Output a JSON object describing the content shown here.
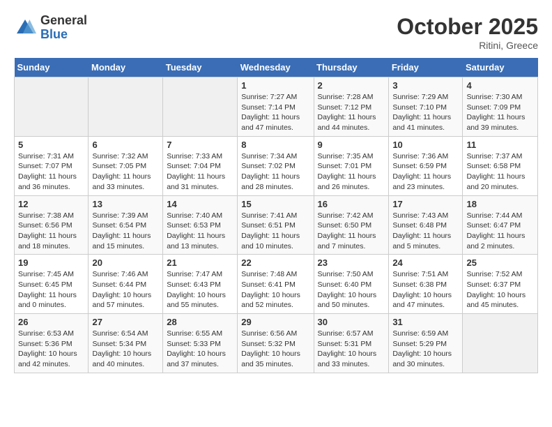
{
  "header": {
    "logo_general": "General",
    "logo_blue": "Blue",
    "title": "October 2025",
    "subtitle": "Ritini, Greece"
  },
  "weekdays": [
    "Sunday",
    "Monday",
    "Tuesday",
    "Wednesday",
    "Thursday",
    "Friday",
    "Saturday"
  ],
  "weeks": [
    [
      {
        "day": "",
        "empty": true
      },
      {
        "day": "",
        "empty": true
      },
      {
        "day": "",
        "empty": true
      },
      {
        "day": "1",
        "sunrise": "7:27 AM",
        "sunset": "7:14 PM",
        "daylight": "11 hours and 47 minutes."
      },
      {
        "day": "2",
        "sunrise": "7:28 AM",
        "sunset": "7:12 PM",
        "daylight": "11 hours and 44 minutes."
      },
      {
        "day": "3",
        "sunrise": "7:29 AM",
        "sunset": "7:10 PM",
        "daylight": "11 hours and 41 minutes."
      },
      {
        "day": "4",
        "sunrise": "7:30 AM",
        "sunset": "7:09 PM",
        "daylight": "11 hours and 39 minutes."
      }
    ],
    [
      {
        "day": "5",
        "sunrise": "7:31 AM",
        "sunset": "7:07 PM",
        "daylight": "11 hours and 36 minutes."
      },
      {
        "day": "6",
        "sunrise": "7:32 AM",
        "sunset": "7:05 PM",
        "daylight": "11 hours and 33 minutes."
      },
      {
        "day": "7",
        "sunrise": "7:33 AM",
        "sunset": "7:04 PM",
        "daylight": "11 hours and 31 minutes."
      },
      {
        "day": "8",
        "sunrise": "7:34 AM",
        "sunset": "7:02 PM",
        "daylight": "11 hours and 28 minutes."
      },
      {
        "day": "9",
        "sunrise": "7:35 AM",
        "sunset": "7:01 PM",
        "daylight": "11 hours and 26 minutes."
      },
      {
        "day": "10",
        "sunrise": "7:36 AM",
        "sunset": "6:59 PM",
        "daylight": "11 hours and 23 minutes."
      },
      {
        "day": "11",
        "sunrise": "7:37 AM",
        "sunset": "6:58 PM",
        "daylight": "11 hours and 20 minutes."
      }
    ],
    [
      {
        "day": "12",
        "sunrise": "7:38 AM",
        "sunset": "6:56 PM",
        "daylight": "11 hours and 18 minutes."
      },
      {
        "day": "13",
        "sunrise": "7:39 AM",
        "sunset": "6:54 PM",
        "daylight": "11 hours and 15 minutes."
      },
      {
        "day": "14",
        "sunrise": "7:40 AM",
        "sunset": "6:53 PM",
        "daylight": "11 hours and 13 minutes."
      },
      {
        "day": "15",
        "sunrise": "7:41 AM",
        "sunset": "6:51 PM",
        "daylight": "11 hours and 10 minutes."
      },
      {
        "day": "16",
        "sunrise": "7:42 AM",
        "sunset": "6:50 PM",
        "daylight": "11 hours and 7 minutes."
      },
      {
        "day": "17",
        "sunrise": "7:43 AM",
        "sunset": "6:48 PM",
        "daylight": "11 hours and 5 minutes."
      },
      {
        "day": "18",
        "sunrise": "7:44 AM",
        "sunset": "6:47 PM",
        "daylight": "11 hours and 2 minutes."
      }
    ],
    [
      {
        "day": "19",
        "sunrise": "7:45 AM",
        "sunset": "6:45 PM",
        "daylight": "11 hours and 0 minutes."
      },
      {
        "day": "20",
        "sunrise": "7:46 AM",
        "sunset": "6:44 PM",
        "daylight": "10 hours and 57 minutes."
      },
      {
        "day": "21",
        "sunrise": "7:47 AM",
        "sunset": "6:43 PM",
        "daylight": "10 hours and 55 minutes."
      },
      {
        "day": "22",
        "sunrise": "7:48 AM",
        "sunset": "6:41 PM",
        "daylight": "10 hours and 52 minutes."
      },
      {
        "day": "23",
        "sunrise": "7:50 AM",
        "sunset": "6:40 PM",
        "daylight": "10 hours and 50 minutes."
      },
      {
        "day": "24",
        "sunrise": "7:51 AM",
        "sunset": "6:38 PM",
        "daylight": "10 hours and 47 minutes."
      },
      {
        "day": "25",
        "sunrise": "7:52 AM",
        "sunset": "6:37 PM",
        "daylight": "10 hours and 45 minutes."
      }
    ],
    [
      {
        "day": "26",
        "sunrise": "6:53 AM",
        "sunset": "5:36 PM",
        "daylight": "10 hours and 42 minutes."
      },
      {
        "day": "27",
        "sunrise": "6:54 AM",
        "sunset": "5:34 PM",
        "daylight": "10 hours and 40 minutes."
      },
      {
        "day": "28",
        "sunrise": "6:55 AM",
        "sunset": "5:33 PM",
        "daylight": "10 hours and 37 minutes."
      },
      {
        "day": "29",
        "sunrise": "6:56 AM",
        "sunset": "5:32 PM",
        "daylight": "10 hours and 35 minutes."
      },
      {
        "day": "30",
        "sunrise": "6:57 AM",
        "sunset": "5:31 PM",
        "daylight": "10 hours and 33 minutes."
      },
      {
        "day": "31",
        "sunrise": "6:59 AM",
        "sunset": "5:29 PM",
        "daylight": "10 hours and 30 minutes."
      },
      {
        "day": "",
        "empty": true
      }
    ]
  ]
}
